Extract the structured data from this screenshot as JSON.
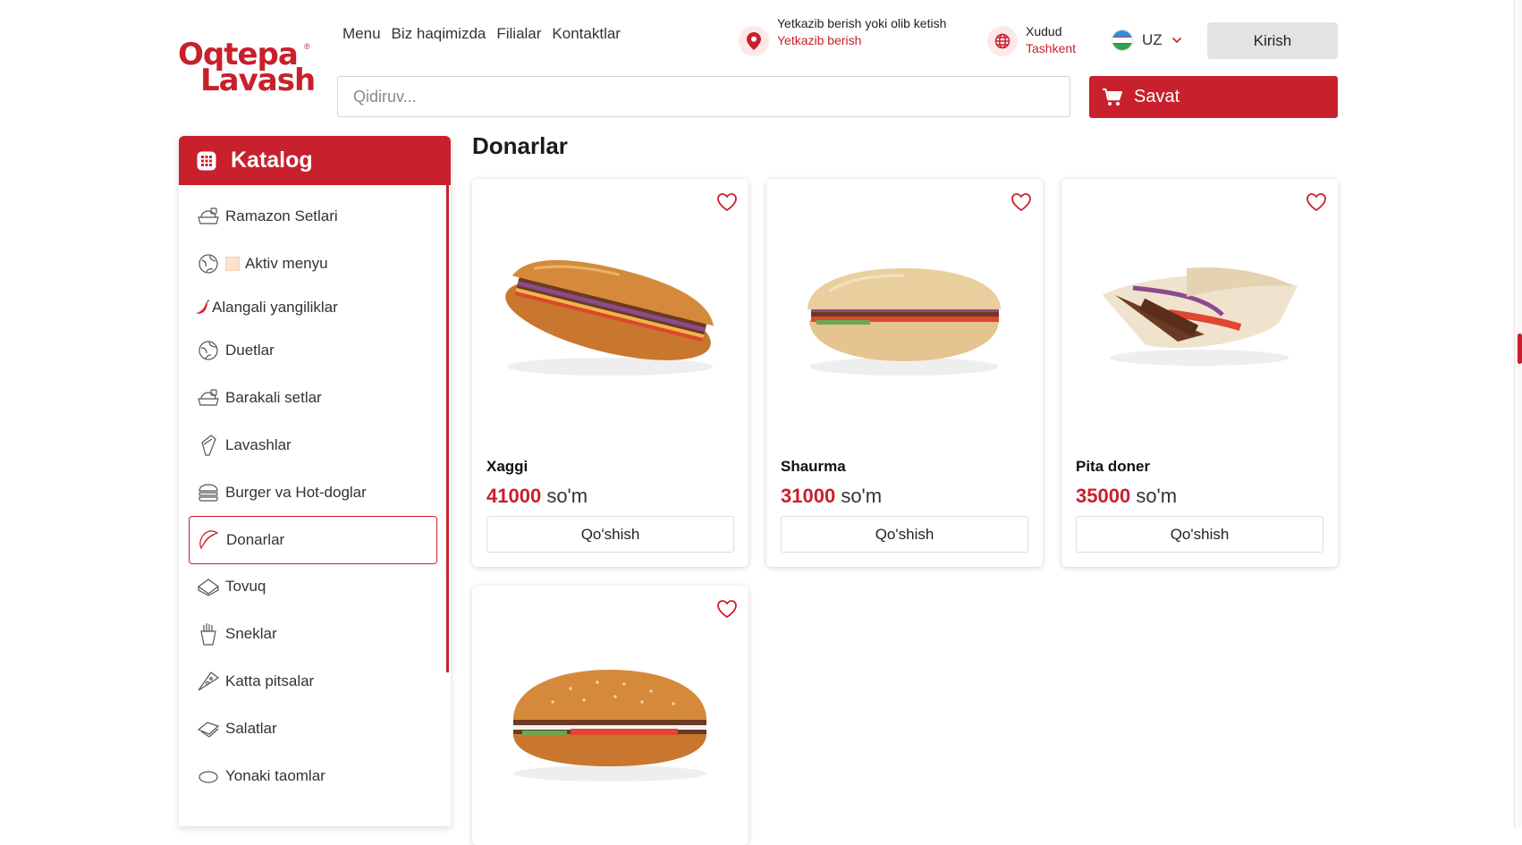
{
  "brand": {
    "line1": "Oqtepa",
    "line2": "Lavash",
    "mark": "®"
  },
  "nav": [
    "Menu",
    "Biz haqimizda",
    "Filialar",
    "Kontaktlar"
  ],
  "delivery": {
    "title": "Yetkazib berish yoki olib ketish",
    "value": "Yetkazib berish"
  },
  "region": {
    "title": "Xudud",
    "value": "Tashkent"
  },
  "language": "UZ",
  "login_label": "Kirish",
  "search": {
    "placeholder": "Qidiruv...",
    "value": ""
  },
  "cart_label": "Savat",
  "catalog": {
    "title": "Katalog",
    "items": [
      {
        "label": "Ramazon Setlari",
        "icon": "set-icon"
      },
      {
        "label": "Aktiv menyu",
        "icon": "globe-icon",
        "badge": "emoji-icon"
      },
      {
        "label": "Alangali yangiliklar",
        "icon": "chili-pepper-icon"
      },
      {
        "label": "Duetlar",
        "icon": "globe-icon"
      },
      {
        "label": "Barakali setlar",
        "icon": "set-icon"
      },
      {
        "label": "Lavashlar",
        "icon": "lavash-icon"
      },
      {
        "label": "Burger va Hot-doglar",
        "icon": "burger-icon"
      },
      {
        "label": "Donarlar",
        "icon": "doner-icon",
        "active": true
      },
      {
        "label": "Tovuq",
        "icon": "chicken-icon"
      },
      {
        "label": "Sneklar",
        "icon": "fries-icon"
      },
      {
        "label": "Katta pitsalar",
        "icon": "pizza-icon"
      },
      {
        "label": "Salatlar",
        "icon": "salad-icon"
      },
      {
        "label": "Yonaki taomlar",
        "icon": "side-dish-icon"
      }
    ]
  },
  "page_title": "Donarlar",
  "currency": "so'm",
  "add_label": "Qo'shish",
  "products": [
    {
      "name": "Xaggi",
      "price": "41000",
      "image": "sub-sandwich"
    },
    {
      "name": "Shaurma",
      "price": "31000",
      "image": "pita-sandwich"
    },
    {
      "name": "Pita doner",
      "price": "35000",
      "image": "pita-pocket"
    },
    {
      "name": "",
      "price": "",
      "image": "sesame-bun-doner"
    }
  ],
  "colors": {
    "accent": "#c8202c",
    "accent_soft": "#fde8e8",
    "button_gray": "#e3e3e3"
  }
}
